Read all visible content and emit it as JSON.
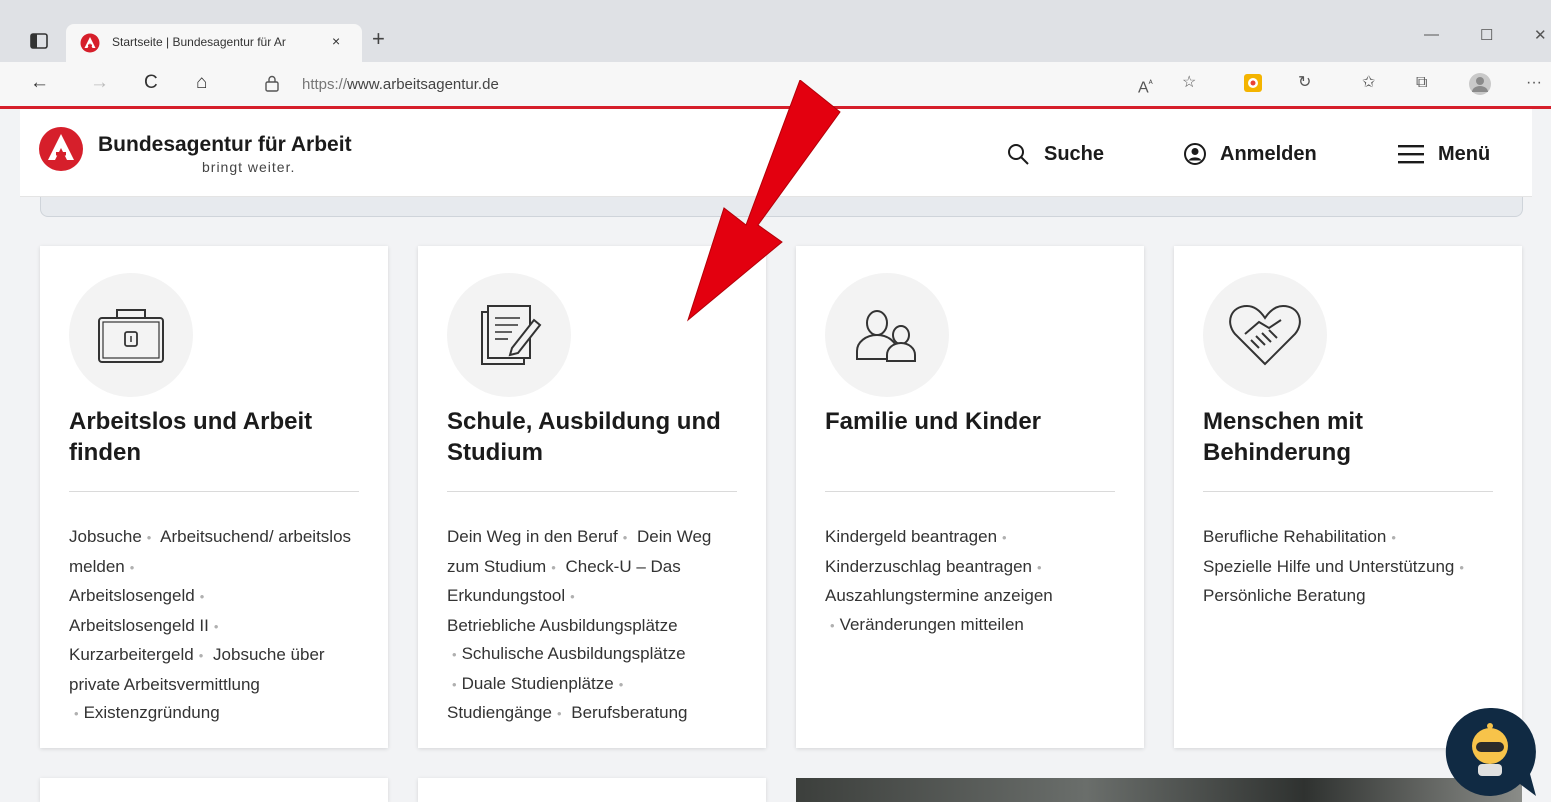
{
  "browser": {
    "tab_title": "Startseite | Bundesagentur für Ar",
    "tab_close": "×",
    "new_tab": "+",
    "url_scheme": "https://",
    "url_host": "www.arbeitsagentur.de",
    "back": "←",
    "forward": "→",
    "reload": "C",
    "home": "⌂",
    "min": "—",
    "max": "☐",
    "close": "✕",
    "more": "···",
    "read_aloud": "A",
    "icons": [
      "read-aloud-icon",
      "favorite-star-icon",
      "extension-icon",
      "refresh-alt-icon",
      "favorites-icon",
      "collections-icon",
      "profile-icon",
      "more-icon"
    ]
  },
  "header": {
    "brand": "Bundesagentur für Arbeit",
    "slogan": "bringt weiter.",
    "search": "Suche",
    "login": "Anmelden",
    "menu": "Menü"
  },
  "cards": [
    {
      "heading": "Arbeitslos und Arbeit finden",
      "icon": "briefcase-icon",
      "links": [
        "Jobsuche",
        "Arbeitsuchend/ arbeitslos melden",
        "Arbeitslosengeld",
        "Arbeitslosengeld II",
        "Kurzarbeitergeld",
        "Jobsuche über private Arbeitsvermittlung",
        "Existenzgründung"
      ]
    },
    {
      "heading": "Schule, Ausbildung und Studium",
      "icon": "document-pen-icon",
      "links": [
        "Dein Weg in den Beruf",
        "Dein Weg zum Studium",
        "Check-U – Das Erkundungstool",
        "Betriebliche Ausbildungsplätze",
        "Schulische Ausbildungsplätze",
        "Duale Studienplätze",
        "Studiengänge",
        "Berufsberatung"
      ]
    },
    {
      "heading": "Familie und Kinder",
      "icon": "family-icon",
      "links": [
        "Kindergeld beantragen",
        "Kinderzuschlag beantragen",
        "Auszahlungstermine anzeigen",
        "Veränderungen mitteilen"
      ]
    },
    {
      "heading": "Menschen mit Behinderung",
      "icon": "heart-handshake-icon",
      "links": [
        "Berufliche Rehabilitation",
        "Spezielle Hilfe und Unterstützung",
        "Persönliche Beratung"
      ]
    }
  ],
  "colors": {
    "brand_red": "#d61f2b",
    "arrow_red": "#e3000f",
    "text": "#1b1b1b"
  }
}
